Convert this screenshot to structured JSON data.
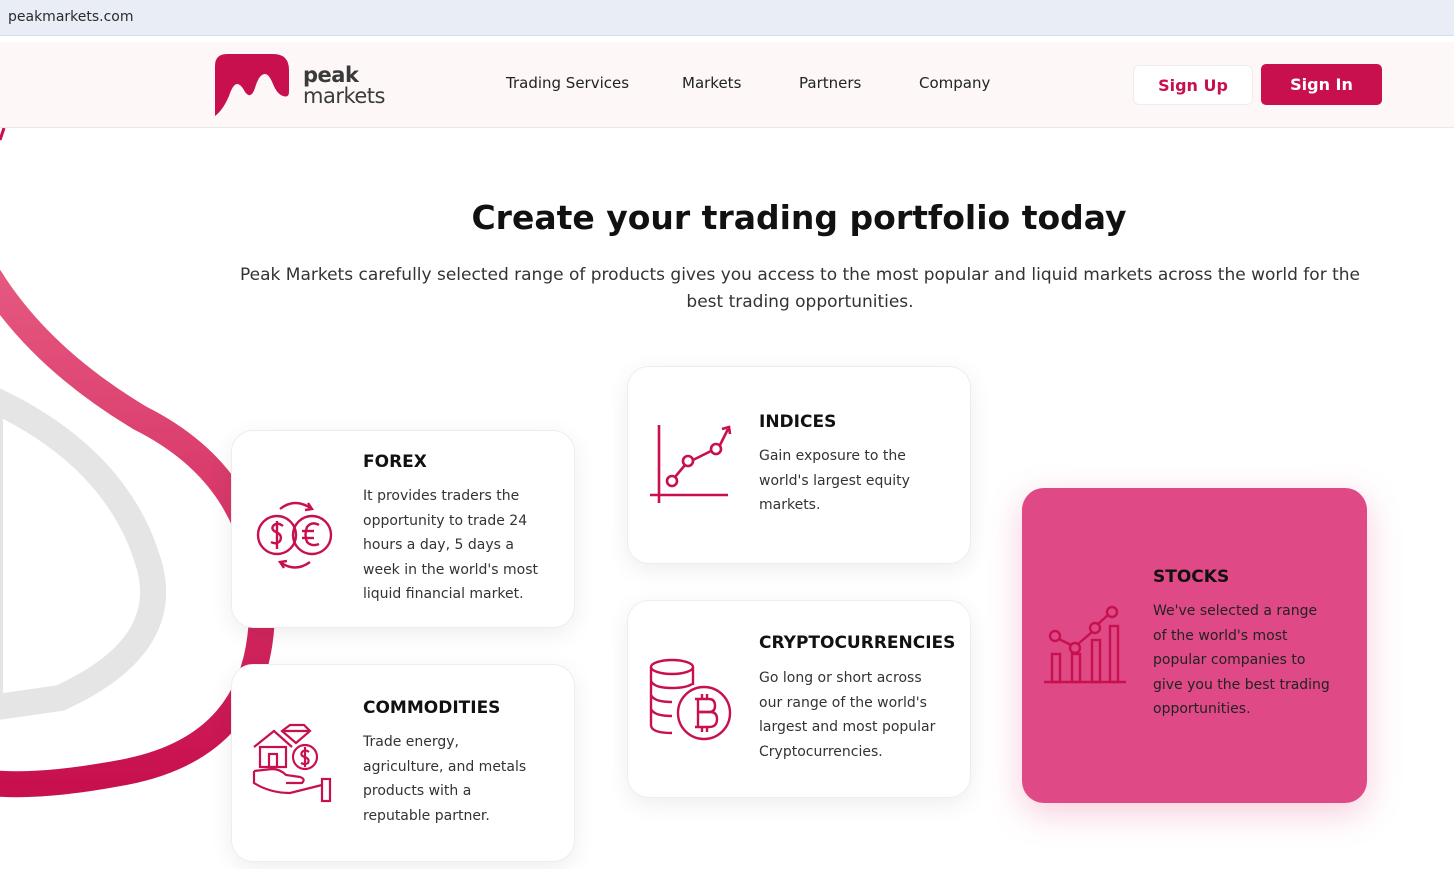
{
  "browser": {
    "url": "peakmarkets.com"
  },
  "brand": {
    "line1": "peak",
    "line2": "markets"
  },
  "nav": {
    "items": [
      "Trading Services",
      "Markets",
      "Partners",
      "Company"
    ]
  },
  "auth": {
    "signup_label": "Sign Up",
    "signin_label": "Sign In"
  },
  "hero": {
    "title": "Create your trading portfolio today",
    "subtitle": "Peak Markets carefully selected range of products gives you access to the most popular and liquid markets across the world for the best trading opportunities."
  },
  "cards": {
    "forex": {
      "title": "FOREX",
      "desc": "It provides traders the opportunity to trade 24 hours a day, 5 days a week in the world's most liquid financial market.",
      "icon": "currency-exchange-icon"
    },
    "indices": {
      "title": "INDICES",
      "desc": "Gain exposure to the world's largest equity markets.",
      "icon": "line-chart-icon"
    },
    "crypto": {
      "title": "CRYPTOCURRENCIES",
      "desc": "Go long or short across our range of the world's largest and most popular Cryptocurrencies.",
      "icon": "bitcoin-coins-icon"
    },
    "commodities": {
      "title": "COMMODITIES",
      "desc": "Trade energy, agriculture, and metals products with a reputable partner.",
      "icon": "commodities-hand-icon"
    },
    "stocks": {
      "title": "STOCKS",
      "desc": "We've selected a range of the world's most popular companies to give you the best trading opportunities.",
      "icon": "bar-chart-growth-icon"
    }
  },
  "colors": {
    "accent": "#c8104f",
    "stocks_bg": "#df4a86",
    "header_bg": "#fdf8f7"
  }
}
